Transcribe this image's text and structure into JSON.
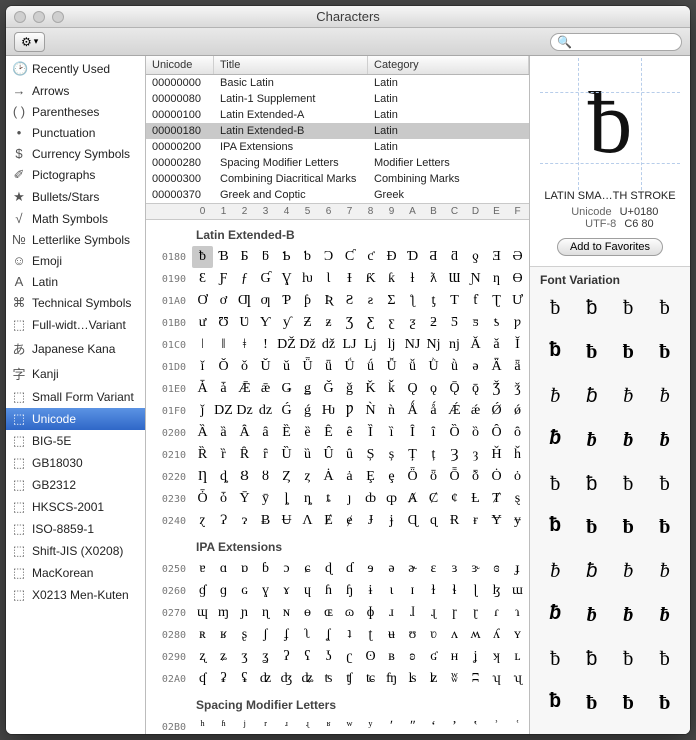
{
  "window": {
    "title": "Characters"
  },
  "toolbar": {
    "search_placeholder": ""
  },
  "sidebar": {
    "items": [
      {
        "icon": "🕑",
        "label": "Recently Used"
      },
      {
        "icon": "→",
        "label": "Arrows"
      },
      {
        "icon": "( )",
        "label": "Parentheses"
      },
      {
        "icon": "•",
        "label": "Punctuation"
      },
      {
        "icon": "$",
        "label": "Currency Symbols"
      },
      {
        "icon": "✐",
        "label": "Pictographs"
      },
      {
        "icon": "★",
        "label": "Bullets/Stars"
      },
      {
        "icon": "√",
        "label": "Math Symbols"
      },
      {
        "icon": "№",
        "label": "Letterlike Symbols"
      },
      {
        "icon": "☺",
        "label": "Emoji"
      },
      {
        "icon": "A",
        "label": "Latin"
      },
      {
        "icon": "⌘",
        "label": "Technical Symbols"
      },
      {
        "icon": "⬚",
        "label": "Full-widt…Variant"
      },
      {
        "icon": "あ",
        "label": "Japanese Kana"
      },
      {
        "icon": "字",
        "label": "Kanji"
      },
      {
        "icon": "⬚",
        "label": "Small Form Variant"
      },
      {
        "icon": "⬚",
        "label": "Unicode"
      },
      {
        "icon": "⬚",
        "label": "BIG-5E"
      },
      {
        "icon": "⬚",
        "label": "GB18030"
      },
      {
        "icon": "⬚",
        "label": "GB2312"
      },
      {
        "icon": "⬚",
        "label": "HKSCS-2001"
      },
      {
        "icon": "⬚",
        "label": "ISO-8859-1"
      },
      {
        "icon": "⬚",
        "label": "Shift-JIS (X0208)"
      },
      {
        "icon": "⬚",
        "label": "MacKorean"
      },
      {
        "icon": "⬚",
        "label": "X0213 Men-Kuten"
      }
    ],
    "selected_index": 16
  },
  "table": {
    "headers": [
      "Unicode",
      "Title",
      "Category"
    ],
    "rows": [
      {
        "unicode": "00000000",
        "title": "Basic Latin",
        "category": "Latin"
      },
      {
        "unicode": "00000080",
        "title": "Latin-1 Supplement",
        "category": "Latin"
      },
      {
        "unicode": "00000100",
        "title": "Latin Extended-A",
        "category": "Latin"
      },
      {
        "unicode": "00000180",
        "title": "Latin Extended-B",
        "category": "Latin"
      },
      {
        "unicode": "00000200",
        "title": "IPA Extensions",
        "category": "Latin"
      },
      {
        "unicode": "00000280",
        "title": "Spacing Modifier Letters",
        "category": "Modifier Letters"
      },
      {
        "unicode": "00000300",
        "title": "Combining Diacritical Marks",
        "category": "Combining Marks"
      },
      {
        "unicode": "00000370",
        "title": "Greek and Coptic",
        "category": "Greek"
      }
    ],
    "selected_index": 3
  },
  "hex_header": [
    "0",
    "1",
    "2",
    "3",
    "4",
    "5",
    "6",
    "7",
    "8",
    "9",
    "A",
    "B",
    "C",
    "D",
    "E",
    "F"
  ],
  "grid": {
    "sections": [
      {
        "title": "Latin Extended-B",
        "rows": [
          {
            "code": "0180",
            "chars": [
              "ƀ",
              "Ɓ",
              "Ƃ",
              "ƃ",
              "Ƅ",
              "ƅ",
              "Ɔ",
              "Ƈ",
              "ƈ",
              "Ɖ",
              "Ɗ",
              "Ƌ",
              "ƌ",
              "ƍ",
              "Ǝ",
              "Ə"
            ]
          },
          {
            "code": "0190",
            "chars": [
              "Ɛ",
              "Ƒ",
              "ƒ",
              "Ɠ",
              "Ɣ",
              "ƕ",
              "Ɩ",
              "Ɨ",
              "Ƙ",
              "ƙ",
              "ƚ",
              "ƛ",
              "Ɯ",
              "Ɲ",
              "ƞ",
              "Ɵ"
            ]
          },
          {
            "code": "01A0",
            "chars": [
              "Ơ",
              "ơ",
              "Ƣ",
              "ƣ",
              "Ƥ",
              "ƥ",
              "Ʀ",
              "Ƨ",
              "ƨ",
              "Ʃ",
              "ƪ",
              "ƫ",
              "Ƭ",
              "ƭ",
              "Ʈ",
              "Ư"
            ]
          },
          {
            "code": "01B0",
            "chars": [
              "ư",
              "Ʊ",
              "Ʋ",
              "Ƴ",
              "ƴ",
              "Ƶ",
              "ƶ",
              "Ʒ",
              "Ƹ",
              "ƹ",
              "ƺ",
              "ƻ",
              "Ƽ",
              "ƽ",
              "ƾ",
              "ƿ"
            ]
          },
          {
            "code": "01C0",
            "chars": [
              "ǀ",
              "ǁ",
              "ǂ",
              "ǃ",
              "Ǆ",
              "ǅ",
              "ǆ",
              "Ǉ",
              "ǈ",
              "ǉ",
              "Ǌ",
              "ǋ",
              "ǌ",
              "Ǎ",
              "ǎ",
              "Ǐ"
            ]
          },
          {
            "code": "01D0",
            "chars": [
              "ǐ",
              "Ǒ",
              "ǒ",
              "Ǔ",
              "ǔ",
              "Ǖ",
              "ǖ",
              "Ǘ",
              "ǘ",
              "Ǚ",
              "ǚ",
              "Ǜ",
              "ǜ",
              "ǝ",
              "Ǟ",
              "ǟ"
            ]
          },
          {
            "code": "01E0",
            "chars": [
              "Ǡ",
              "ǡ",
              "Ǣ",
              "ǣ",
              "Ǥ",
              "ǥ",
              "Ǧ",
              "ǧ",
              "Ǩ",
              "ǩ",
              "Ǫ",
              "ǫ",
              "Ǭ",
              "ǭ",
              "Ǯ",
              "ǯ"
            ]
          },
          {
            "code": "01F0",
            "chars": [
              "ǰ",
              "Ǳ",
              "ǲ",
              "ǳ",
              "Ǵ",
              "ǵ",
              "Ƕ",
              "Ƿ",
              "Ǹ",
              "ǹ",
              "Ǻ",
              "ǻ",
              "Ǽ",
              "ǽ",
              "Ǿ",
              "ǿ"
            ]
          },
          {
            "code": "0200",
            "chars": [
              "Ȁ",
              "ȁ",
              "Ȃ",
              "ȃ",
              "Ȅ",
              "ȅ",
              "Ȇ",
              "ȇ",
              "Ȉ",
              "ȉ",
              "Ȋ",
              "ȋ",
              "Ȍ",
              "ȍ",
              "Ȏ",
              "ȏ"
            ]
          },
          {
            "code": "0210",
            "chars": [
              "Ȑ",
              "ȑ",
              "Ȓ",
              "ȓ",
              "Ȕ",
              "ȕ",
              "Ȗ",
              "ȗ",
              "Ș",
              "ș",
              "Ț",
              "ț",
              "Ȝ",
              "ȝ",
              "Ȟ",
              "ȟ"
            ]
          },
          {
            "code": "0220",
            "chars": [
              "Ƞ",
              "ȡ",
              "Ȣ",
              "ȣ",
              "Ȥ",
              "ȥ",
              "Ȧ",
              "ȧ",
              "Ȩ",
              "ȩ",
              "Ȫ",
              "ȫ",
              "Ȭ",
              "ȭ",
              "Ȯ",
              "ȯ"
            ]
          },
          {
            "code": "0230",
            "chars": [
              "Ȱ",
              "ȱ",
              "Ȳ",
              "ȳ",
              "ȴ",
              "ȵ",
              "ȶ",
              "ȷ",
              "ȸ",
              "ȹ",
              "Ⱥ",
              "Ȼ",
              "ȼ",
              "Ƚ",
              "Ⱦ",
              "ȿ"
            ]
          },
          {
            "code": "0240",
            "chars": [
              "ɀ",
              "Ɂ",
              "ɂ",
              "Ƀ",
              "Ʉ",
              "Ʌ",
              "Ɇ",
              "ɇ",
              "Ɉ",
              "ɉ",
              "Ɋ",
              "ɋ",
              "Ɍ",
              "ɍ",
              "Ɏ",
              "ɏ"
            ]
          }
        ],
        "selected": {
          "row": 0,
          "col": 0
        }
      },
      {
        "title": "IPA Extensions",
        "rows": [
          {
            "code": "0250",
            "chars": [
              "ɐ",
              "ɑ",
              "ɒ",
              "ɓ",
              "ɔ",
              "ɕ",
              "ɖ",
              "ɗ",
              "ɘ",
              "ə",
              "ɚ",
              "ɛ",
              "ɜ",
              "ɝ",
              "ɞ",
              "ɟ"
            ]
          },
          {
            "code": "0260",
            "chars": [
              "ɠ",
              "ɡ",
              "ɢ",
              "ɣ",
              "ɤ",
              "ɥ",
              "ɦ",
              "ɧ",
              "ɨ",
              "ɩ",
              "ɪ",
              "ɫ",
              "ɬ",
              "ɭ",
              "ɮ",
              "ɯ"
            ]
          },
          {
            "code": "0270",
            "chars": [
              "ɰ",
              "ɱ",
              "ɲ",
              "ɳ",
              "ɴ",
              "ɵ",
              "ɶ",
              "ɷ",
              "ɸ",
              "ɹ",
              "ɺ",
              "ɻ",
              "ɼ",
              "ɽ",
              "ɾ",
              "ɿ"
            ]
          },
          {
            "code": "0280",
            "chars": [
              "ʀ",
              "ʁ",
              "ʂ",
              "ʃ",
              "ʄ",
              "ʅ",
              "ʆ",
              "ʇ",
              "ʈ",
              "ʉ",
              "ʊ",
              "ʋ",
              "ʌ",
              "ʍ",
              "ʎ",
              "ʏ"
            ]
          },
          {
            "code": "0290",
            "chars": [
              "ʐ",
              "ʑ",
              "ʒ",
              "ʓ",
              "ʔ",
              "ʕ",
              "ʖ",
              "ʗ",
              "ʘ",
              "ʙ",
              "ʚ",
              "ʛ",
              "ʜ",
              "ʝ",
              "ʞ",
              "ʟ"
            ]
          },
          {
            "code": "02A0",
            "chars": [
              "ʠ",
              "ʡ",
              "ʢ",
              "ʣ",
              "ʤ",
              "ʥ",
              "ʦ",
              "ʧ",
              "ʨ",
              "ʩ",
              "ʪ",
              "ʫ",
              "ʬ",
              "ʭ",
              "ʮ",
              "ʯ"
            ]
          }
        ]
      },
      {
        "title": "Spacing Modifier Letters",
        "rows": [
          {
            "code": "02B0",
            "chars": [
              "ʰ",
              "ʱ",
              "ʲ",
              "ʳ",
              "ʴ",
              "ʵ",
              "ʶ",
              "ʷ",
              "ʸ",
              "ʹ",
              "ʺ",
              "ʻ",
              "ʼ",
              "ʽ",
              "ʾ",
              "ʿ"
            ]
          }
        ]
      }
    ]
  },
  "detail": {
    "glyph": "ƀ",
    "name": "LATIN SMA…TH STROKE",
    "unicode_label": "Unicode",
    "unicode_value": "U+0180",
    "utf8_label": "UTF-8",
    "utf8_value": "C6 80",
    "favorites_button": "Add to Favorites",
    "variation_header": "Font Variation",
    "variations_count": 40,
    "variation_glyph": "ƀ"
  }
}
